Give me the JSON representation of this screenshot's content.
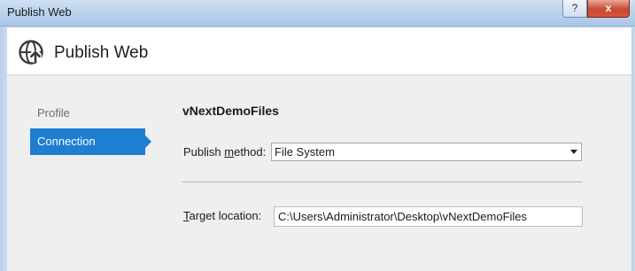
{
  "window": {
    "title": "Publish Web",
    "help_label": "?",
    "close_label": "x"
  },
  "header": {
    "title": "Publish Web",
    "icon": "globe-upload-icon"
  },
  "nav": {
    "items": [
      {
        "label": "Profile",
        "selected": false
      },
      {
        "label": "Connection",
        "selected": true
      }
    ]
  },
  "main": {
    "site_name": "vNextDemoFiles",
    "publish_method": {
      "label_pre": "Publish ",
      "label_mnemonic": "m",
      "label_post": "ethod:",
      "value": "File System"
    },
    "target_location": {
      "label_mnemonic": "T",
      "label_post": "arget location:",
      "value": "C:\\Users\\Administrator\\Desktop\\vNextDemoFiles"
    }
  },
  "colors": {
    "accent": "#1e7ed0",
    "body_bg": "#efefef"
  }
}
